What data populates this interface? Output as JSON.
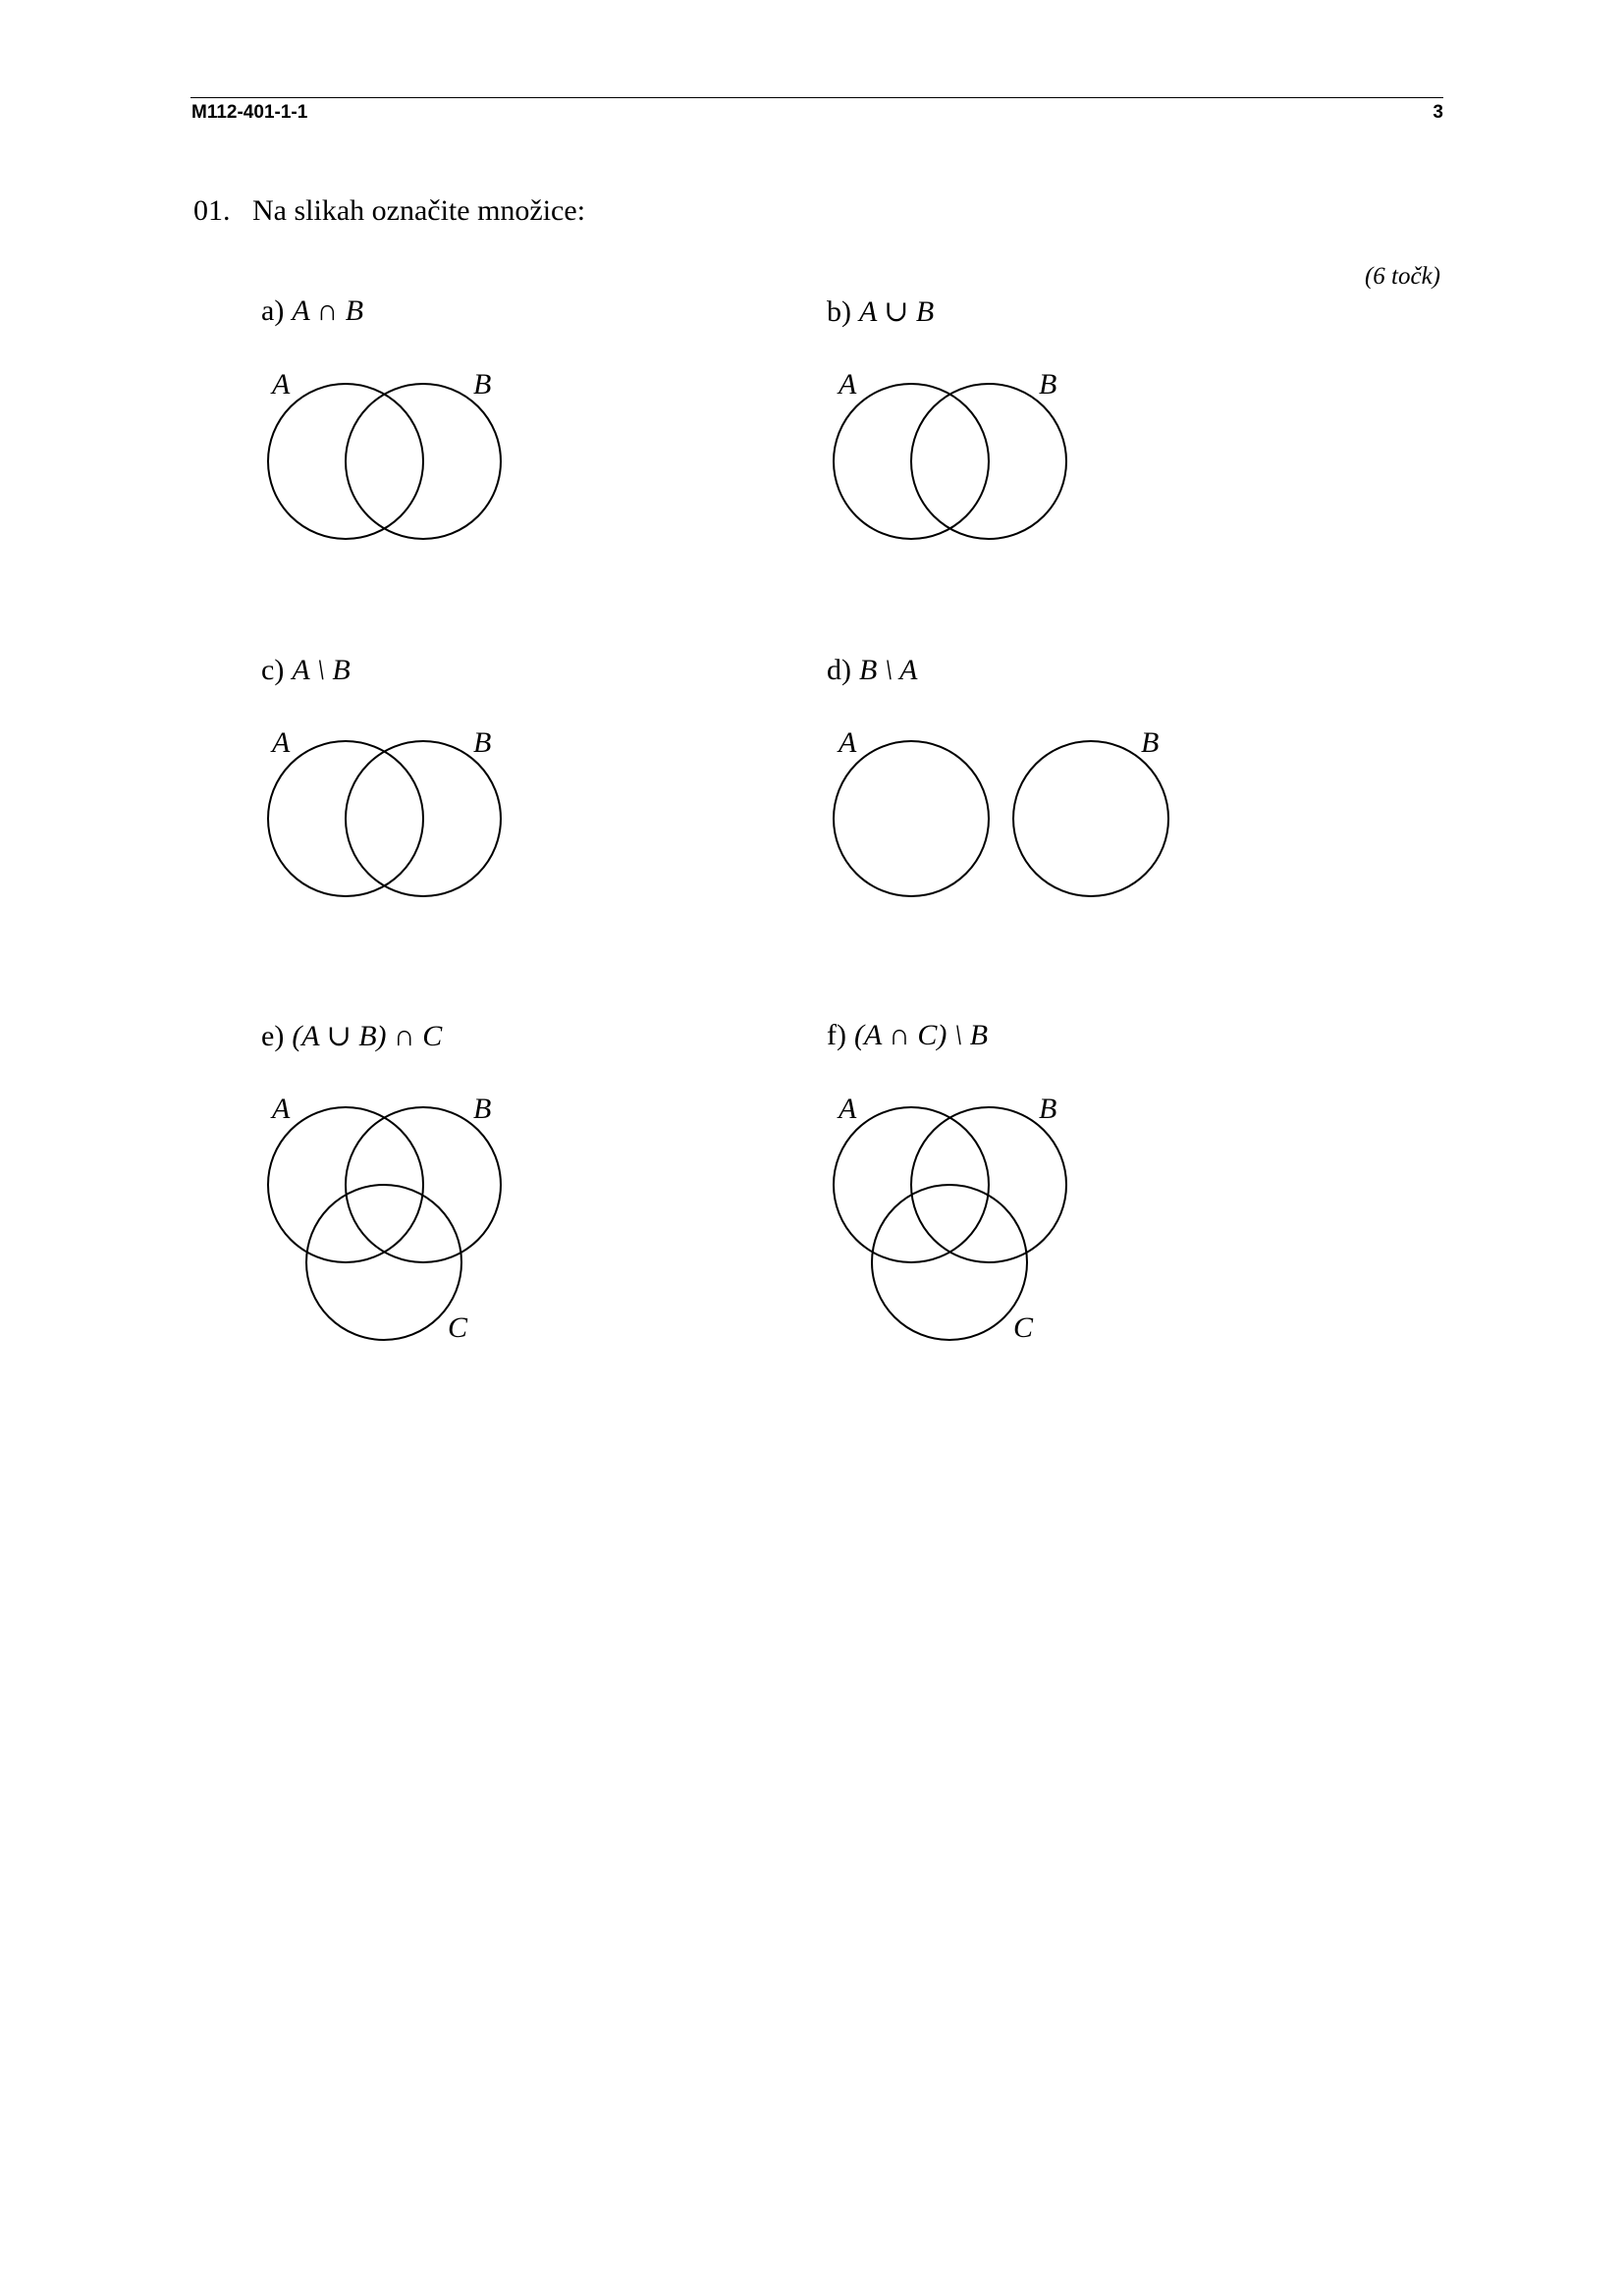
{
  "header": {
    "code": "M112-401-1-1",
    "page_number": "3"
  },
  "question": {
    "number": "01.",
    "text": "Na slikah označite množice:",
    "points": "(6 točk)"
  },
  "tasks": [
    {
      "label": "a)",
      "expression": "A ∩ B",
      "sets": [
        "A",
        "B"
      ]
    },
    {
      "label": "b)",
      "expression": "A ∪ B",
      "sets": [
        "A",
        "B"
      ]
    },
    {
      "label": "c)",
      "expression": "A \\ B",
      "sets": [
        "A",
        "B"
      ]
    },
    {
      "label": "d)",
      "expression": "B \\ A",
      "sets": [
        "A",
        "B"
      ]
    },
    {
      "label": "e)",
      "expression": "(A ∪ B) ∩ C",
      "sets": [
        "A",
        "B",
        "C"
      ]
    },
    {
      "label": "f)",
      "expression": "(A ∩ C) \\ B",
      "sets": [
        "A",
        "B",
        "C"
      ]
    }
  ]
}
